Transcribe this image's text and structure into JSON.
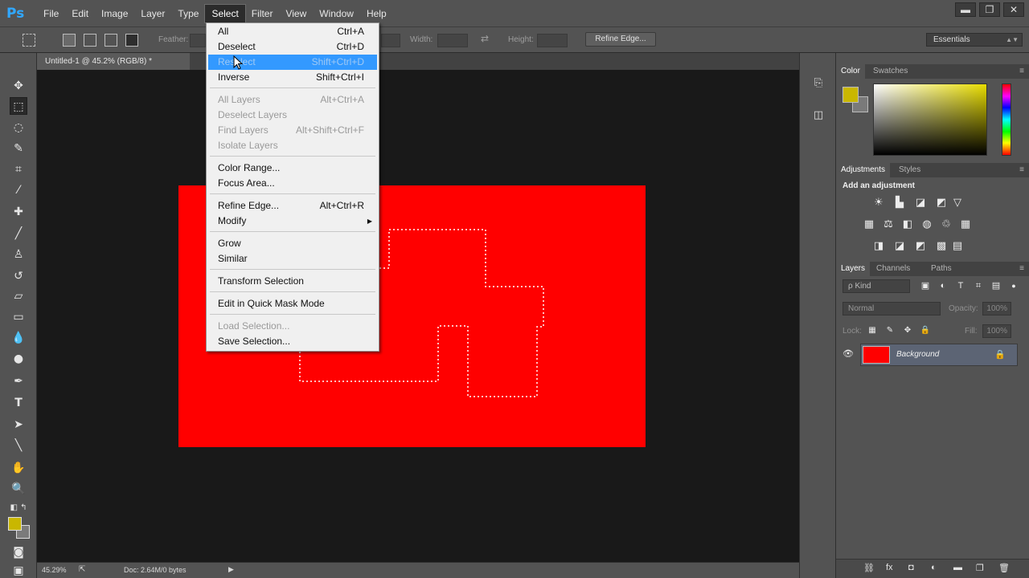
{
  "app": {
    "logo": "Ps"
  },
  "menubar": {
    "items": [
      "File",
      "Edit",
      "Image",
      "Layer",
      "Type",
      "Select",
      "Filter",
      "View",
      "Window",
      "Help"
    ],
    "active": "Select"
  },
  "window_controls": {
    "minimize": "▬",
    "restore": "❐",
    "close": "✕"
  },
  "options": {
    "feather_label": "Feather:",
    "width_label": "Width:",
    "height_label": "Height:",
    "refine_edge": "Refine Edge...",
    "workspace": "Essentials"
  },
  "document": {
    "tab_title": "Untitled-1 @ 45.2% (RGB/8) *",
    "tab_close": "×",
    "canvas_color": "#ff0000"
  },
  "status": {
    "zoom": "45.29%",
    "doc_info": "Doc: 2.64M/0 bytes"
  },
  "colors": {
    "foreground": "#c9b700",
    "background": "#7b7b7b",
    "accent_highlight": "#3399ff"
  },
  "panels": {
    "color_tabs": [
      "Color",
      "Swatches"
    ],
    "adjustment_tabs": [
      "Adjustments",
      "Styles"
    ],
    "adjustments_title": "Add an adjustment",
    "layers_tabs": [
      "Layers",
      "Channels",
      "Paths"
    ],
    "kind_filter": "ρ Kind",
    "blend_mode": "Normal",
    "opacity_label": "Opacity:",
    "opacity_value": "100%",
    "lock_label": "Lock:",
    "fill_label": "Fill:",
    "fill_value": "100%",
    "layers": [
      {
        "name": "Background",
        "locked": true,
        "visible": true
      }
    ]
  },
  "select_menu": {
    "items": [
      {
        "label": "All",
        "shortcut": "Ctrl+A",
        "disabled": false
      },
      {
        "label": "Deselect",
        "shortcut": "Ctrl+D",
        "disabled": false
      },
      {
        "label": "Reselect",
        "shortcut": "Shift+Ctrl+D",
        "disabled": false,
        "hover": true
      },
      {
        "label": "Inverse",
        "shortcut": "Shift+Ctrl+I",
        "disabled": false
      },
      {
        "label": "All Layers",
        "shortcut": "Alt+Ctrl+A",
        "disabled": true
      },
      {
        "label": "Deselect Layers",
        "shortcut": "",
        "disabled": true
      },
      {
        "label": "Find Layers",
        "shortcut": "Alt+Shift+Ctrl+F",
        "disabled": true
      },
      {
        "label": "Isolate Layers",
        "shortcut": "",
        "disabled": true
      },
      {
        "label": "Color Range...",
        "shortcut": "",
        "disabled": false
      },
      {
        "label": "Focus Area...",
        "shortcut": "",
        "disabled": false
      },
      {
        "label": "Refine Edge...",
        "shortcut": "Alt+Ctrl+R",
        "disabled": false
      },
      {
        "label": "Modify",
        "shortcut": "",
        "disabled": false,
        "submenu": true
      },
      {
        "label": "Grow",
        "shortcut": "",
        "disabled": false
      },
      {
        "label": "Similar",
        "shortcut": "",
        "disabled": false
      },
      {
        "label": "Transform Selection",
        "shortcut": "",
        "disabled": false
      },
      {
        "label": "Edit in Quick Mask Mode",
        "shortcut": "",
        "disabled": false
      },
      {
        "label": "Load Selection...",
        "shortcut": "",
        "disabled": true
      },
      {
        "label": "Save Selection...",
        "shortcut": "",
        "disabled": false
      }
    ]
  }
}
